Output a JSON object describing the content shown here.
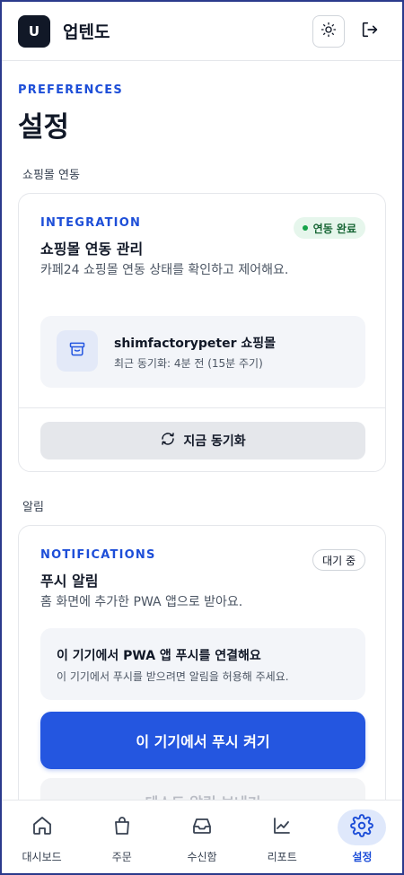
{
  "app": {
    "logo_letter": "U",
    "title": "업텐도"
  },
  "header": {
    "theme_icon": "sun-icon",
    "logout_icon": "logout-icon"
  },
  "page": {
    "eyebrow": "PREFERENCES",
    "title": "설정"
  },
  "integration_section": {
    "label": "쇼핑몰 연동",
    "eyebrow": "INTEGRATION",
    "title": "쇼핑몰 연동 관리",
    "description": "카페24 쇼핑몰 연동 상태를 확인하고 제어해요.",
    "status_badge": "연동 완료",
    "status_color": "#16a34a",
    "store_name": "shimfactorypeter 쇼핑몰",
    "store_sync": "최근 동기화: 4분 전 (15분 주기)",
    "sync_button": "지금 동기화"
  },
  "notification_section": {
    "label": "알림",
    "eyebrow": "NOTIFICATIONS",
    "title": "푸시 알림",
    "description": "홈 화면에 추가한 PWA 앱으로 받아요.",
    "status_badge": "대기 중",
    "info_title": "이 기기에서 PWA 앱 푸시를 연결해요",
    "info_desc": "이 기기에서 푸시를 받으려면 알림을 허용해 주세요.",
    "push_button": "이 기기에서 푸시 켜기",
    "test_button": "테스트 알림 보내기"
  },
  "nav": {
    "items": [
      {
        "label": "대시보드",
        "icon": "home-icon",
        "active": false
      },
      {
        "label": "주문",
        "icon": "shopping-bag-icon",
        "active": false
      },
      {
        "label": "수신함",
        "icon": "inbox-icon",
        "active": false
      },
      {
        "label": "리포트",
        "icon": "chart-icon",
        "active": false
      },
      {
        "label": "설정",
        "icon": "gear-icon",
        "active": true
      }
    ]
  },
  "colors": {
    "accent": "#2456e0",
    "eyebrow": "#1d4ed8",
    "logo_bg": "#111827"
  }
}
